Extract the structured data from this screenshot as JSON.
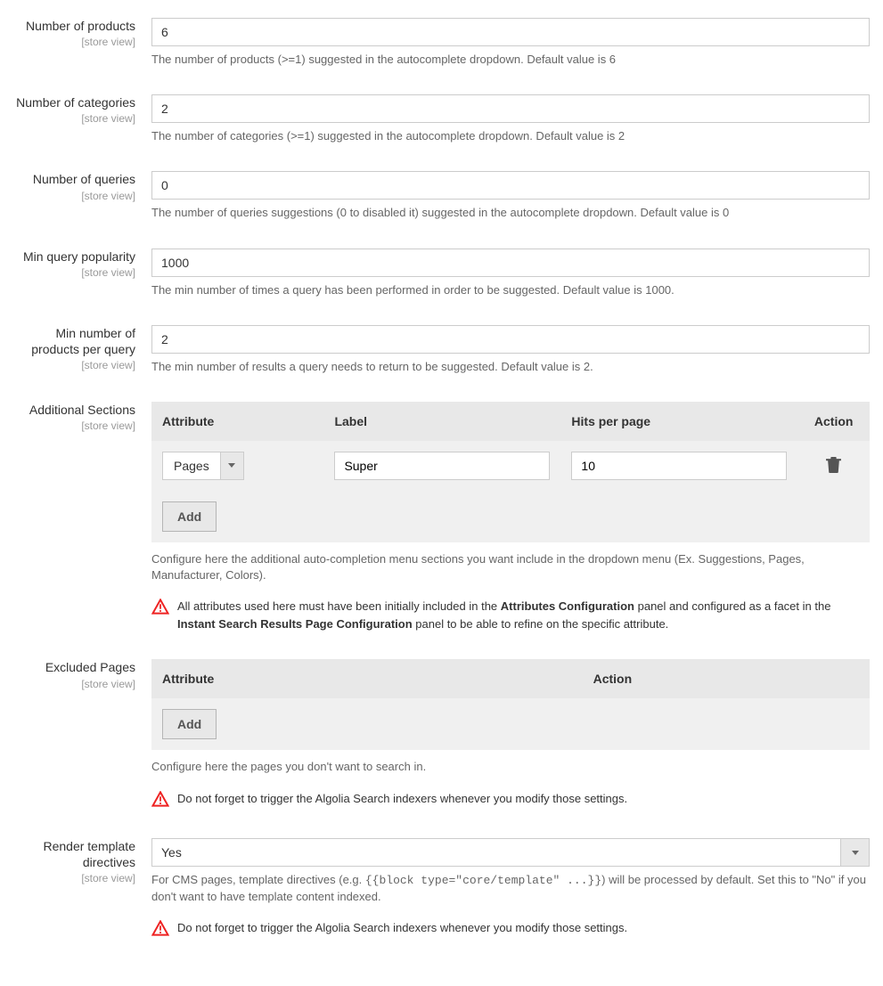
{
  "scope_label": "[store view]",
  "fields": {
    "num_products": {
      "label": "Number of products",
      "value": "6",
      "help": "The number of products (>=1) suggested in the autocomplete dropdown. Default value is 6"
    },
    "num_categories": {
      "label": "Number of categories",
      "value": "2",
      "help": "The number of categories (>=1) suggested in the autocomplete dropdown. Default value is 2"
    },
    "num_queries": {
      "label": "Number of queries",
      "value": "0",
      "help": "The number of queries suggestions (0 to disabled it) suggested in the autocomplete dropdown. Default value is 0"
    },
    "min_popularity": {
      "label": "Min query popularity",
      "value": "1000",
      "help": "The min number of times a query has been performed in order to be suggested. Default value is 1000."
    },
    "min_products_query": {
      "label": "Min number of products per query",
      "value": "2",
      "help": "The min number of results a query needs to return to be suggested. Default value is 2."
    },
    "additional": {
      "label": "Additional Sections",
      "cols": {
        "attribute": "Attribute",
        "labelcol": "Label",
        "hits": "Hits per page",
        "action": "Action"
      },
      "row": {
        "attr": "Pages",
        "label": "Super",
        "hits": "10"
      },
      "add": "Add",
      "help": "Configure here the additional auto-completion menu sections you want include in the dropdown menu (Ex. Suggestions, Pages, Manufacturer, Colors).",
      "warn_pre": "All attributes used here must have been initially included in the ",
      "warn_b1": "Attributes Configuration",
      "warn_mid": " panel and configured as a facet in the ",
      "warn_b2": "Instant Search Results Page Configuration",
      "warn_post": " panel to be able to refine on the specific attribute."
    },
    "excluded": {
      "label": "Excluded Pages",
      "cols": {
        "attribute": "Attribute",
        "action": "Action"
      },
      "add": "Add",
      "help": "Configure here the pages you don't want to search in.",
      "warn": "Do not forget to trigger the Algolia Search indexers whenever you modify those settings."
    },
    "render": {
      "label": "Render template directives",
      "value": "Yes",
      "help_pre": "For CMS pages, template directives (e.g. ",
      "help_code": "{{block type=\"core/template\" ...}}",
      "help_post": ") will be processed by default. Set this to \"No\" if you don't want to have template content indexed.",
      "warn": "Do not forget to trigger the Algolia Search indexers whenever you modify those settings."
    }
  }
}
